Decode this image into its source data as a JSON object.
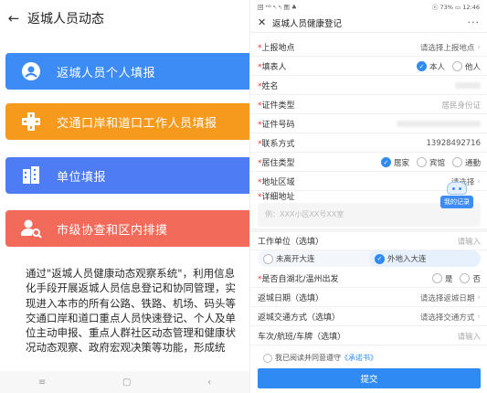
{
  "left": {
    "back_icon": "←",
    "title": "返城人员动态",
    "menu": [
      {
        "label": "返城人员个人填报",
        "icon": "person-circle-icon",
        "color": "#3d8cf5"
      },
      {
        "label": "交通口岸和道口工作人员填报",
        "icon": "road-checkpoint-icon",
        "color": "#f59a1c"
      },
      {
        "label": "单位填报",
        "icon": "building-icon",
        "color": "#4e7cf2"
      },
      {
        "label": "市级协查和区内排摸",
        "icon": "person-search-icon",
        "color": "#f26a5a"
      }
    ],
    "description": "通过\"返城人员健康动态观察系统\"，利用信息化手段开展返城人员信息登记和协同管理，实现进入本市的所有公路、铁路、机场、码头等交通口岸和道口重点人员快速登记、个人及单位主动申报、重点人群社区动态管理和健康状况动态观察、政府宏观决策等功能，形成统",
    "nav": [
      "≡",
      "▢",
      "‹"
    ]
  },
  "right": {
    "status_left": "回 ᴴᴰ ᵃᵢ ᵃᵢ 图 ♣",
    "status_right": "ⓝ 73% ▭ 12:46",
    "close_icon": "✕",
    "title": "返城人员健康登记",
    "more_icon": "···",
    "fields": {
      "report_place": {
        "label": "上报地点",
        "value": "请选择上报地点"
      },
      "filler": {
        "label": "填表人",
        "opt1": "本人",
        "opt2": "他人"
      },
      "name": {
        "label": "姓名"
      },
      "id_type": {
        "label": "证件类型",
        "value": "居民身份证"
      },
      "id_number": {
        "label": "证件号码"
      },
      "phone": {
        "label": "联系方式",
        "value": "13928492716"
      },
      "residence": {
        "label": "居住类型",
        "opt1": "居家",
        "opt2": "宾馆",
        "opt3": "通勤"
      },
      "region": {
        "label": "地址区域",
        "value": "请选择"
      },
      "address": {
        "label": "详细地址",
        "placeholder": "例：XXX小区XX号XX室"
      },
      "record": "我的记录",
      "employer": {
        "label": "工作单位（选填）",
        "value": "请输入"
      },
      "segment": {
        "opt1": "未离开大连",
        "opt2": "外地入大连"
      },
      "hubei": {
        "label": "是否自湖北/温州出发",
        "opt1": "是",
        "opt2": "否"
      },
      "return_date": {
        "label": "返城日期（选填）",
        "value": "请选择返城日期"
      },
      "transport": {
        "label": "返城交通方式（选填）",
        "value": "请选择交通方式"
      },
      "vehicle": {
        "label": "车次/航班/车牌（选填）",
        "value": "请输入"
      }
    },
    "terms_prefix": "我已阅读并同意遵守",
    "terms_link": "《承诺书》",
    "submit": "提交"
  }
}
